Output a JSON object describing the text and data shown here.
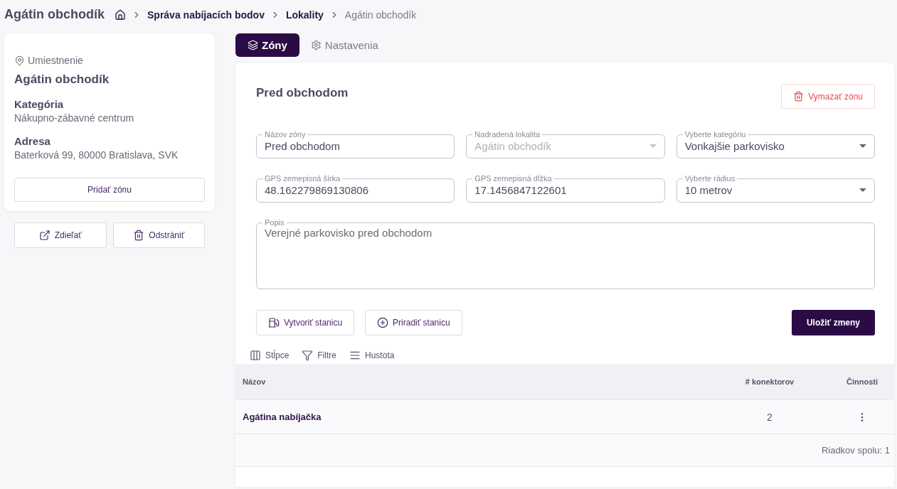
{
  "header": {
    "title": "Agátin obchodík",
    "breadcrumbs": [
      {
        "label": "Správa nabíjacích bodov",
        "current": false
      },
      {
        "label": "Lokality",
        "current": false
      },
      {
        "label": "Agátin obchodík",
        "current": true
      }
    ]
  },
  "location_card": {
    "caption": "Umiestnenie",
    "name": "Agátin obchodík",
    "details": [
      {
        "label": "Kategória",
        "value": "Nákupno-zábavné centrum"
      },
      {
        "label": "Adresa",
        "value": "Baterková 99, 80000 Bratislava, SVK"
      }
    ],
    "add_zone_button": "Pridať zónu"
  },
  "location_actions": [
    {
      "kind": "share",
      "label": "Zdieľať"
    },
    {
      "kind": "delete",
      "label": "Odstrániť"
    }
  ],
  "tabs": [
    {
      "kind": "zones",
      "label": "Zóny",
      "selected": true
    },
    {
      "kind": "settings",
      "label": "Nastavenia",
      "selected": false
    }
  ],
  "zone": {
    "title": "Pred obchodom",
    "delete_button": "Vymazať zónu",
    "fields": [
      {
        "kind": "text",
        "label": "Názov zóny",
        "value": "Pred obchodom",
        "disabled": false
      },
      {
        "kind": "select",
        "label": "Nadradená lokalita",
        "value": "Agátin obchodík",
        "disabled": true
      },
      {
        "kind": "select",
        "label": "Vyberte kategóriu",
        "value": "Vonkajšie parkovisko",
        "disabled": false
      },
      {
        "kind": "text",
        "label": "GPS zemepisná šírka",
        "value": "48.162279869130806",
        "disabled": false
      },
      {
        "kind": "text",
        "label": "GPS zemepisná dĺžka",
        "value": "17.1456847122601",
        "disabled": false
      },
      {
        "kind": "select",
        "label": "Vyberte rádius",
        "value": "10 metrov",
        "disabled": false
      }
    ],
    "description": {
      "label": "Popis",
      "value": "Verejné parkovisko pred obchodom"
    },
    "station_buttons": [
      {
        "kind": "create",
        "label": "Vytvoriť stanicu"
      },
      {
        "kind": "assign",
        "label": "Priradiť stanicu"
      }
    ],
    "save_button": "Uložiť zmeny"
  },
  "table_toolbar": [
    {
      "kind": "columns",
      "label": "Stĺpce"
    },
    {
      "kind": "filter",
      "label": "Filtre"
    },
    {
      "kind": "density",
      "label": "Hustota"
    }
  ],
  "table": {
    "columns": [
      "Názov",
      "# konektorov",
      "Činnosti"
    ],
    "rows": [
      {
        "name": "Agátina nabíjačka",
        "connectors": "2"
      }
    ],
    "footer": "Riadkov spolu: 1"
  }
}
